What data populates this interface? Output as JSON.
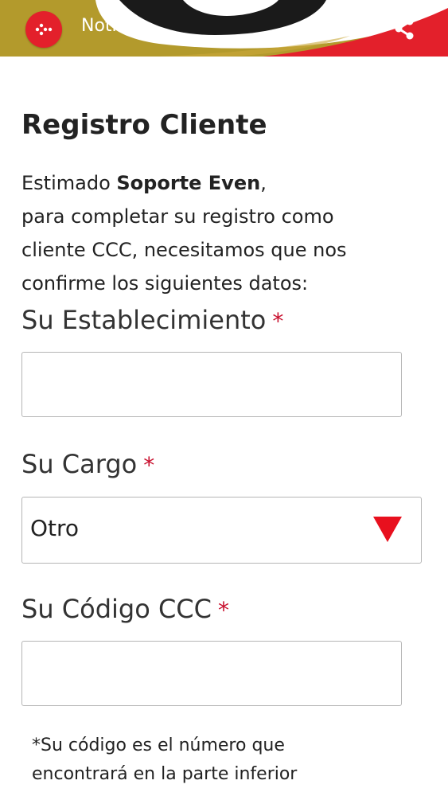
{
  "header": {
    "title": "Notic",
    "back_icon": "back-arrow-icon",
    "share_icon": "share-icon",
    "colors": {
      "bar": "#b39a2c",
      "accent_red": "#e3202b",
      "swoosh_dark": "#1a1a1a"
    }
  },
  "page": {
    "title": "Registro Cliente"
  },
  "intro": {
    "greeting": "Estimado ",
    "name": "Soporte Even",
    "greeting_end": ",",
    "line2": "para completar su registro como",
    "line3": "cliente CCC, necesitamos que nos",
    "line4": "confirme los siguientes datos:"
  },
  "form": {
    "required_mark": "*",
    "establishment": {
      "label": "Su Establecimiento",
      "value": ""
    },
    "position": {
      "label": "Su Cargo",
      "selected": "Otro"
    },
    "code": {
      "label": "Su Código CCC",
      "value": ""
    }
  },
  "note": {
    "line1": "*Su código es el número que",
    "line2": "encontrará en la parte inferior"
  }
}
